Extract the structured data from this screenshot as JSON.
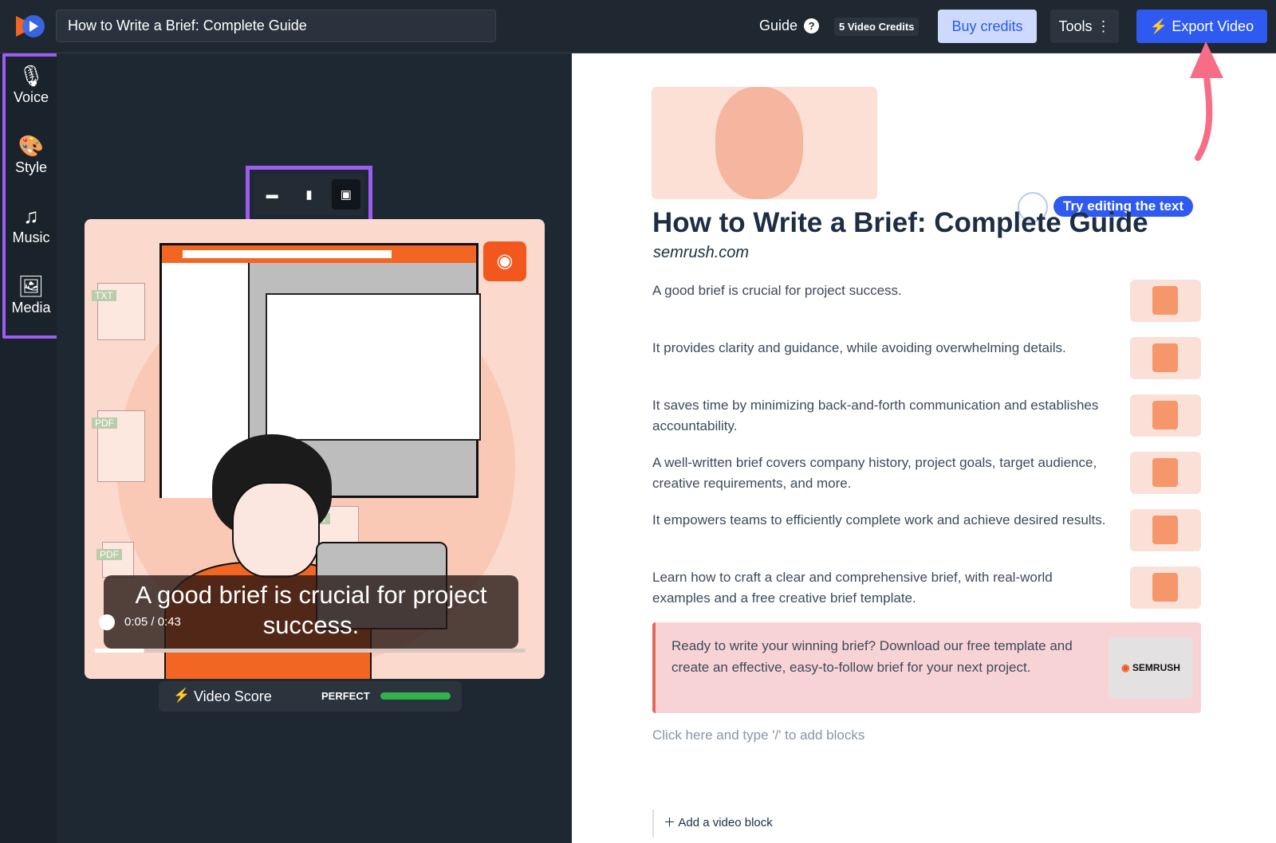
{
  "header": {
    "title": "How to Write a Brief: Complete Guide",
    "guide_label": "Guide",
    "help_icon": "?",
    "credits": "5 Video Credits",
    "buy_label": "Buy credits",
    "tools_label": "Tools",
    "export_label": "Export Video"
  },
  "sidebar": {
    "items": [
      {
        "label": "Voice",
        "icon": "microphone-icon"
      },
      {
        "label": "Style",
        "icon": "palette-icon"
      },
      {
        "label": "Music",
        "icon": "music-note-icon"
      },
      {
        "label": "Media",
        "icon": "media-icon"
      }
    ]
  },
  "player": {
    "caption": "A good brief is crucial for project success.",
    "time": "0:05 / 0:43",
    "progress": 0.116,
    "doc_labels": [
      "TXT",
      "PDF",
      "TXT",
      "PDF"
    ]
  },
  "score": {
    "label": "Video Score",
    "status": "PERFECT",
    "level": 1.0,
    "color": "#2fb34a"
  },
  "doc": {
    "try_label": "Try editing the text",
    "title": "How to Write a Brief: Complete Guide",
    "source": "semrush.com",
    "items": [
      "A good brief is crucial for project success.",
      "It provides clarity and guidance, while avoiding overwhelming details.",
      "It saves time by minimizing back-and-forth communication and establishes accountability.",
      "A well-written brief covers company history, project goals, target audience, creative requirements, and more.",
      "It empowers teams to efficiently complete work and achieve desired results.",
      "Learn how to craft a clear and comprehensive brief, with real-world examples and a free creative brief template."
    ],
    "cta": "Ready to write your winning brief? Download our free template and create an effective, easy-to-follow brief for your next project.",
    "cta_logo": "SEMRUSH",
    "hint": "Click here and type '/' to add blocks",
    "add_block": "Add a video block"
  },
  "colors": {
    "accent": "#2f5af2",
    "highlight": "#9d5cf2",
    "brand": "#f26522"
  }
}
